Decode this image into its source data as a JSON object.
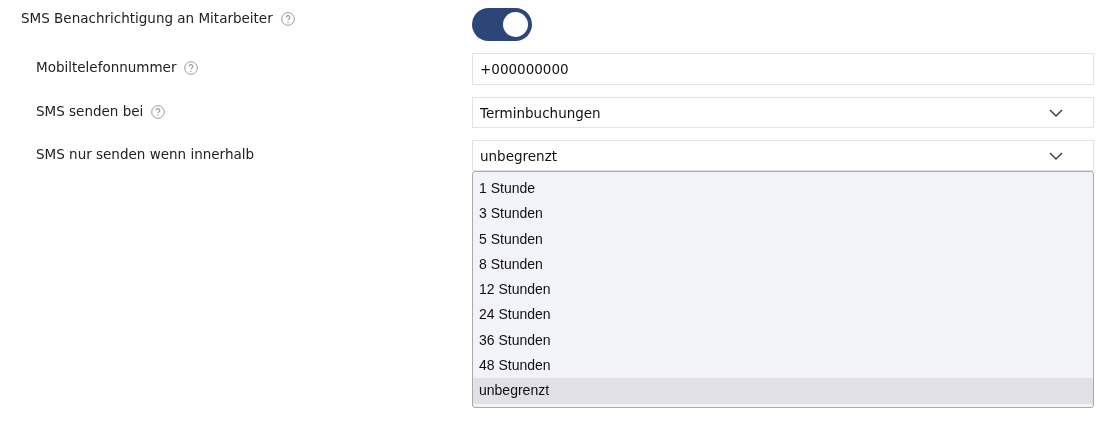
{
  "settings": [
    {
      "label": "SMS Benachrichtigung an Mitarbeiter",
      "help": true,
      "kind": "toggle",
      "on": true,
      "children": [
        {
          "label": "Mobiltelefonnummer",
          "help": true,
          "kind": "input",
          "value": "+000000000"
        },
        {
          "label": "SMS senden bei",
          "help": true,
          "kind": "select",
          "value": "Terminbuchungen",
          "expanded": false
        },
        {
          "label": "SMS nur senden wenn innerhalb",
          "help": false,
          "kind": "select",
          "value": "unbegrenzt",
          "expanded": true,
          "options": [
            {
              "label": "1 Stunde",
              "selected": false
            },
            {
              "label": "3 Stunden",
              "selected": false
            },
            {
              "label": "5 Stunden",
              "selected": false
            },
            {
              "label": "8 Stunden",
              "selected": false
            },
            {
              "label": "12 Stunden",
              "selected": false
            },
            {
              "label": "24 Stunden",
              "selected": false
            },
            {
              "label": "36 Stunden",
              "selected": false
            },
            {
              "label": "48 Stunden",
              "selected": false
            },
            {
              "label": "unbegrenzt",
              "selected": true
            }
          ]
        }
      ]
    }
  ]
}
